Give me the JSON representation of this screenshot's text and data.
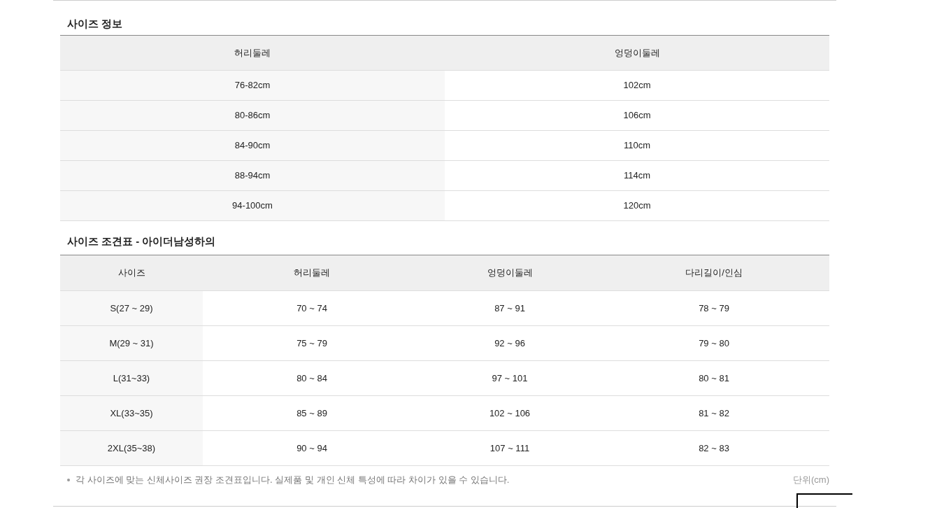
{
  "size_info": {
    "title": "사이즈 정보",
    "columns": [
      "허리둘레",
      "엉덩이둘레"
    ],
    "rows": [
      [
        "76-82cm",
        "102cm"
      ],
      [
        "80-86cm",
        "106cm"
      ],
      [
        "84-90cm",
        "110cm"
      ],
      [
        "88-94cm",
        "114cm"
      ],
      [
        "94-100cm",
        "120cm"
      ]
    ]
  },
  "size_chart": {
    "title": "사이즈 조견표 - 아이더남성하의",
    "columns": [
      "사이즈",
      "허리둘레",
      "엉덩이둘레",
      "다리길이/인심"
    ],
    "rows": [
      [
        "S(27 ~ 29)",
        "70 ~ 74",
        "87 ~ 91",
        "78 ~ 79"
      ],
      [
        "M(29 ~ 31)",
        "75 ~ 79",
        "92 ~ 96",
        "79 ~ 80"
      ],
      [
        "L(31~33)",
        "80 ~ 84",
        "97 ~ 101",
        "80 ~ 81"
      ],
      [
        "XL(33~35)",
        "85 ~ 89",
        "102 ~ 106",
        "81 ~ 82"
      ],
      [
        "2XL(35~38)",
        "90 ~ 94",
        "107 ~ 111",
        "82 ~ 83"
      ]
    ]
  },
  "note": "각 사이즈에 맞는 신체사이즈 권장 조견표입니다. 실제품 및 개인 신체 특성에 따라 차이가 있을 수 있습니다.",
  "unit": "단위(cm)"
}
